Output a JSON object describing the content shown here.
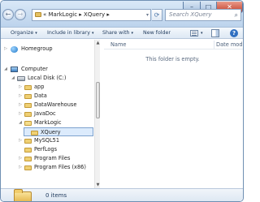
{
  "window": {
    "minimize_glyph": "–",
    "maximize_glyph": "□",
    "close_glyph": "✕"
  },
  "navigation": {
    "back_glyph": "←",
    "forward_glyph": "→",
    "address_path": "« MarkLogic ▸ XQuery ▸",
    "address_dropdown_glyph": "▾",
    "refresh_glyph": "⟳",
    "search_placeholder": "Search XQuery",
    "search_icon": "search-icon"
  },
  "toolbar": {
    "organize": "Organize",
    "include_in_library": "Include in library",
    "share_with": "Share with",
    "new_folder": "New folder",
    "caret": "▾",
    "help_glyph": "?"
  },
  "navpane": {
    "homegroup": "Homegroup",
    "computer": "Computer",
    "local_disk": "Local Disk (C:)",
    "folders": [
      {
        "label": "app"
      },
      {
        "label": "Data"
      },
      {
        "label": "DataWarehouse"
      },
      {
        "label": "JavaDoc"
      },
      {
        "label": "MarkLogic"
      },
      {
        "label": "XQuery"
      },
      {
        "label": "MySQL51"
      },
      {
        "label": "PerfLogs"
      },
      {
        "label": "Program Files"
      },
      {
        "label": "Program Files (x86)"
      }
    ],
    "selected": "XQuery",
    "tri_collapsed": "▷",
    "tri_expanded": "◢"
  },
  "content": {
    "column_name": "Name",
    "column_date": "Date modified",
    "empty_message": "This folder is empty."
  },
  "status": {
    "item_count": "0 items"
  },
  "colors": {
    "accent": "#2f6fc1",
    "selection": "#dcebfc",
    "folder": "#efd074"
  }
}
